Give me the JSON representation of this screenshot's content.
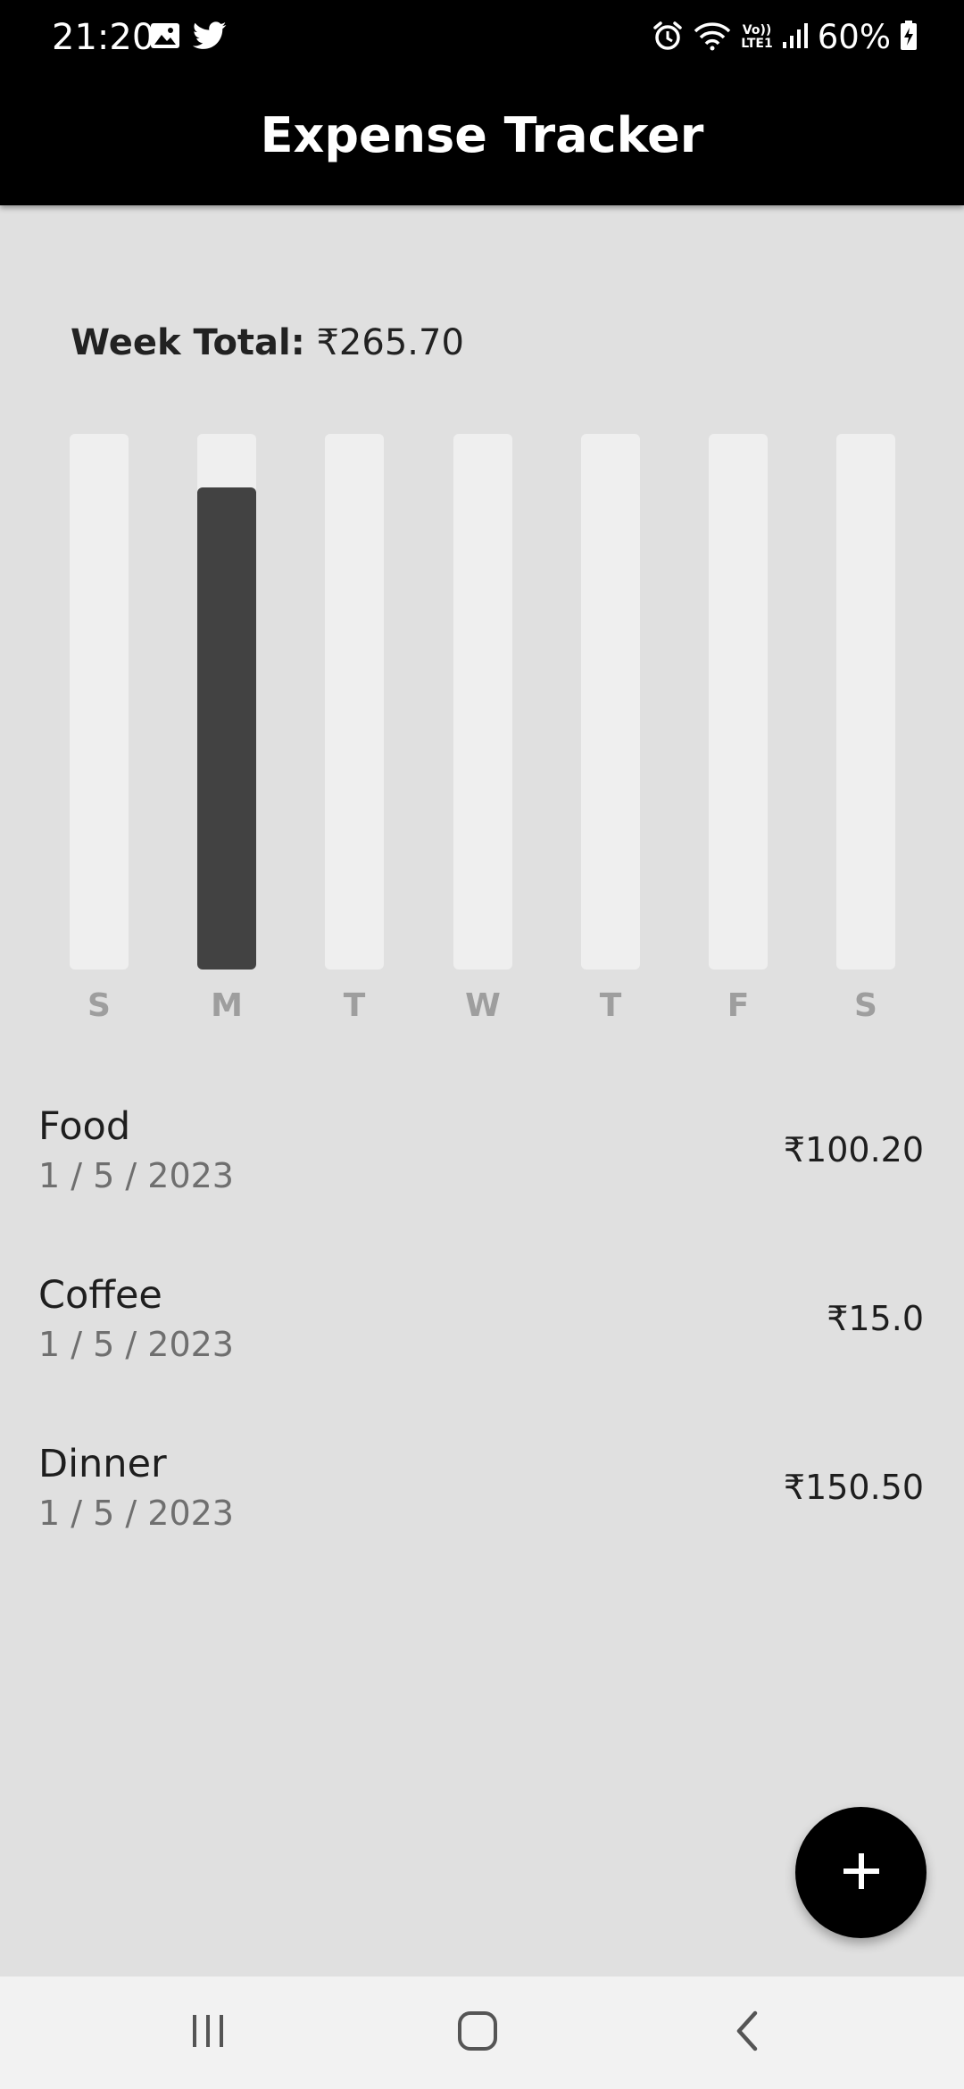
{
  "status_bar": {
    "time": "21:20",
    "battery": "60%",
    "network_label_top": "Vo))",
    "network_label_bottom": "LTE1",
    "icons": [
      "image-icon",
      "twitter-icon",
      "alarm-icon",
      "wifi-icon",
      "signal-icon",
      "battery-charging-icon"
    ]
  },
  "app_bar": {
    "title": "Expense Tracker"
  },
  "summary": {
    "week_total_label": "Week Total:",
    "week_total_value": "₹265.70"
  },
  "chart_data": {
    "type": "bar",
    "categories": [
      "S",
      "M",
      "T",
      "W",
      "T",
      "F",
      "S"
    ],
    "values": [
      0,
      0.9,
      0,
      0,
      0,
      0,
      0
    ],
    "value_unit": "fraction of week total",
    "colors": {
      "track": "#efefef",
      "fill": "#424242",
      "label": "#9e9e9e"
    }
  },
  "expenses": [
    {
      "title": "Food",
      "date": "1 / 5 / 2023",
      "amount": "₹100.20"
    },
    {
      "title": "Coffee",
      "date": "1 / 5 / 2023",
      "amount": "₹15.0"
    },
    {
      "title": "Dinner",
      "date": "1 / 5 / 2023",
      "amount": "₹150.50"
    }
  ],
  "fab": {
    "icon": "plus-icon"
  },
  "nav_bar": {
    "buttons": [
      "recent-apps-icon",
      "home-icon",
      "back-icon"
    ]
  },
  "colors": {
    "app_bar": "#000000",
    "background": "#e0e0e0",
    "fab": "#000000"
  }
}
